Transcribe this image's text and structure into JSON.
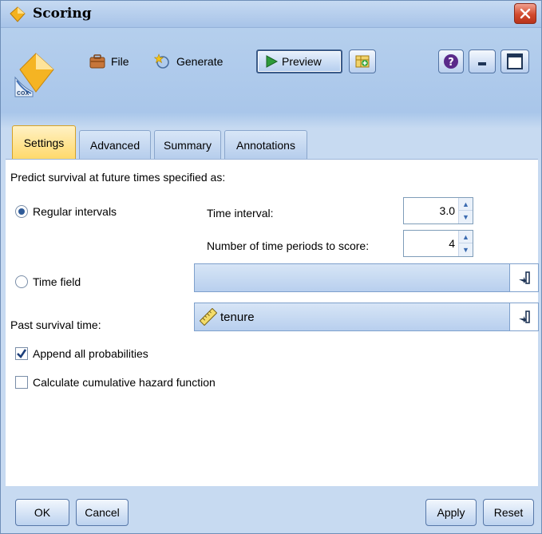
{
  "window": {
    "title": "Scoring"
  },
  "node": {
    "badge_label": "cox"
  },
  "toolbar": {
    "file_label": "File",
    "generate_label": "Generate",
    "preview_label": "Preview"
  },
  "tabs": [
    {
      "label": "Settings",
      "active": true
    },
    {
      "label": "Advanced",
      "active": false
    },
    {
      "label": "Summary",
      "active": false
    },
    {
      "label": "Annotations",
      "active": false
    }
  ],
  "settings": {
    "predict_label": "Predict survival at future times specified as:",
    "regular_intervals_label": "Regular intervals",
    "regular_intervals_selected": true,
    "time_interval_label": "Time interval:",
    "time_interval_value": "3.0",
    "num_periods_label": "Number of time periods to score:",
    "num_periods_value": "4",
    "time_field_label": "Time field",
    "time_field_selected": false,
    "time_field_value": "",
    "past_survival_label": "Past survival time:",
    "past_survival_value": "tenure",
    "append_probabilities_label": "Append all probabilities",
    "append_probabilities_checked": true,
    "cumulative_hazard_label": "Calculate cumulative hazard function",
    "cumulative_hazard_checked": false
  },
  "buttons": {
    "ok": "OK",
    "cancel": "Cancel",
    "apply": "Apply",
    "reset": "Reset"
  },
  "colors": {
    "active_tab": "#ffd96b",
    "close_button": "#d24a2e",
    "field_background": "#b8cfee"
  }
}
